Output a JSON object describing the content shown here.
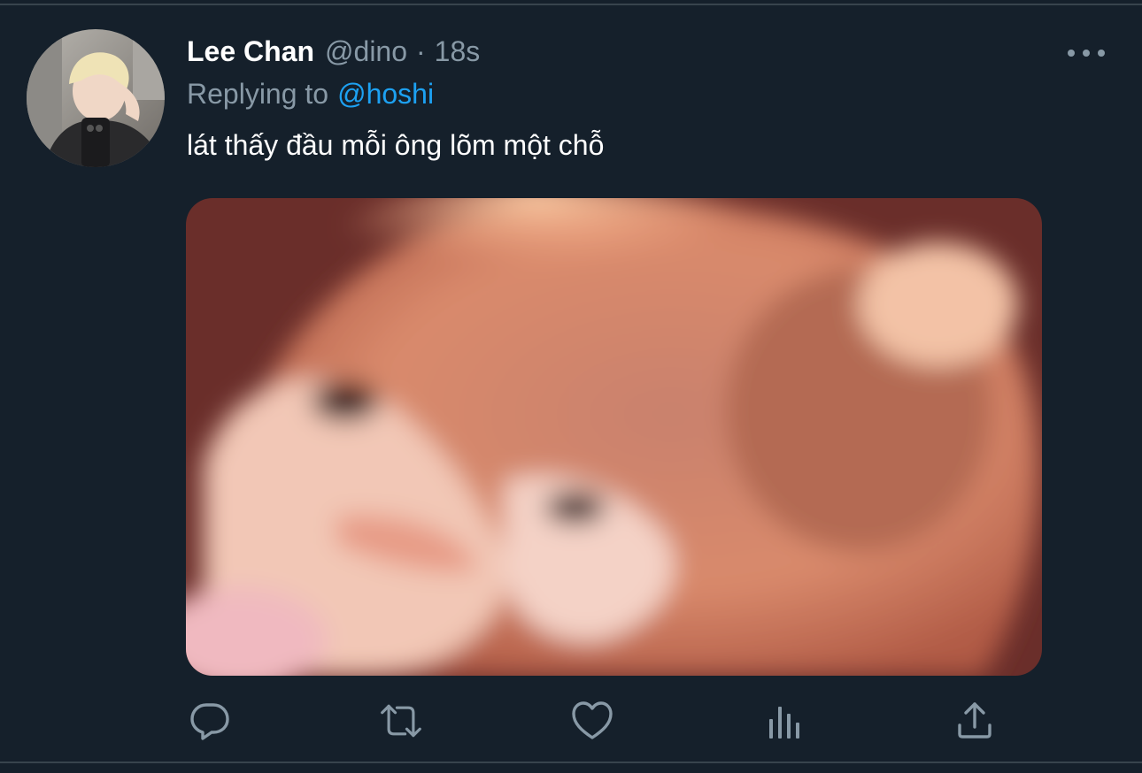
{
  "tweet": {
    "display_name": "Lee Chan",
    "handle": "@dino",
    "separator": "·",
    "timestamp": "18s",
    "replying_to_label": "Replying to",
    "replying_to_mention": "@hoshi",
    "text": "lát thấy đầu mỗi ông lõm một chỗ"
  },
  "actions": {
    "icons": [
      "reply-icon",
      "retweet-icon",
      "like-icon",
      "analytics-icon",
      "share-icon"
    ]
  },
  "colors": {
    "background": "#15202b",
    "divider": "#38444d",
    "primary_text": "#ffffff",
    "secondary_text": "#8899a6",
    "accent": "#1da1f2"
  }
}
